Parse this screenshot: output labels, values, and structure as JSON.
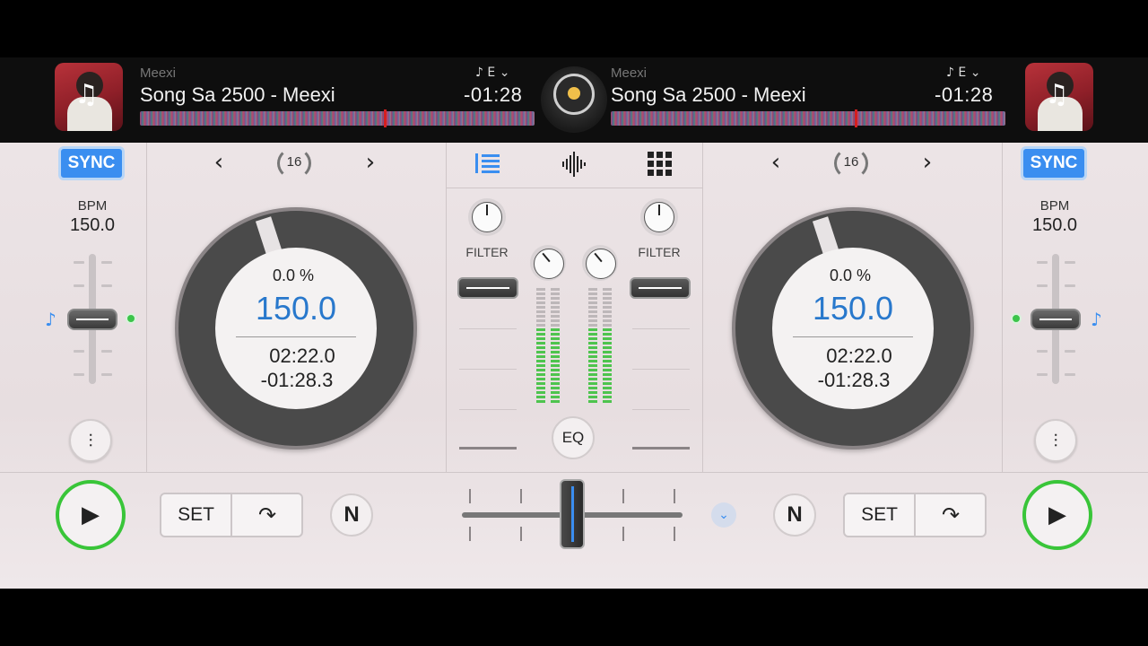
{
  "deckA": {
    "artist": "Meexi",
    "title": "Song Sa 2500 - Meexi",
    "key_note": "♪",
    "key": "E",
    "remaining_header": "-01:28",
    "sync_label": "SYNC",
    "bpm_label": "BPM",
    "bpm_value": "150.0",
    "loop_size": "16",
    "pitch_percent": "0.0 %",
    "platter_bpm": "150.0",
    "elapsed": "02:22.0",
    "remaining": "-01:28.3",
    "set_label": "SET",
    "n_label": "N"
  },
  "deckB": {
    "artist": "Meexi",
    "title": "Song Sa 2500 - Meexi",
    "key_note": "♪",
    "key": "E",
    "remaining_header": "-01:28",
    "sync_label": "SYNC",
    "bpm_label": "BPM",
    "bpm_value": "150.0",
    "loop_size": "16",
    "pitch_percent": "0.0 %",
    "platter_bpm": "150.0",
    "elapsed": "02:22.0",
    "remaining": "-01:28.3",
    "set_label": "SET",
    "n_label": "N"
  },
  "mixer": {
    "filter_label_left": "FILTER",
    "filter_label_right": "FILTER",
    "eq_label": "EQ"
  },
  "colors": {
    "accent": "#3a8ef0",
    "play_ring": "#39c539",
    "meter_on": "#4ec44e",
    "waveform_marker": "#e02020"
  },
  "icons": {
    "play": "play-icon",
    "cue_jump": "cue-jump-icon",
    "chevron": "chevron-down-icon",
    "list": "list-icon",
    "waveform": "waveform-icon",
    "grid": "grid-icon",
    "eq_sliders": "sliders-icon"
  }
}
